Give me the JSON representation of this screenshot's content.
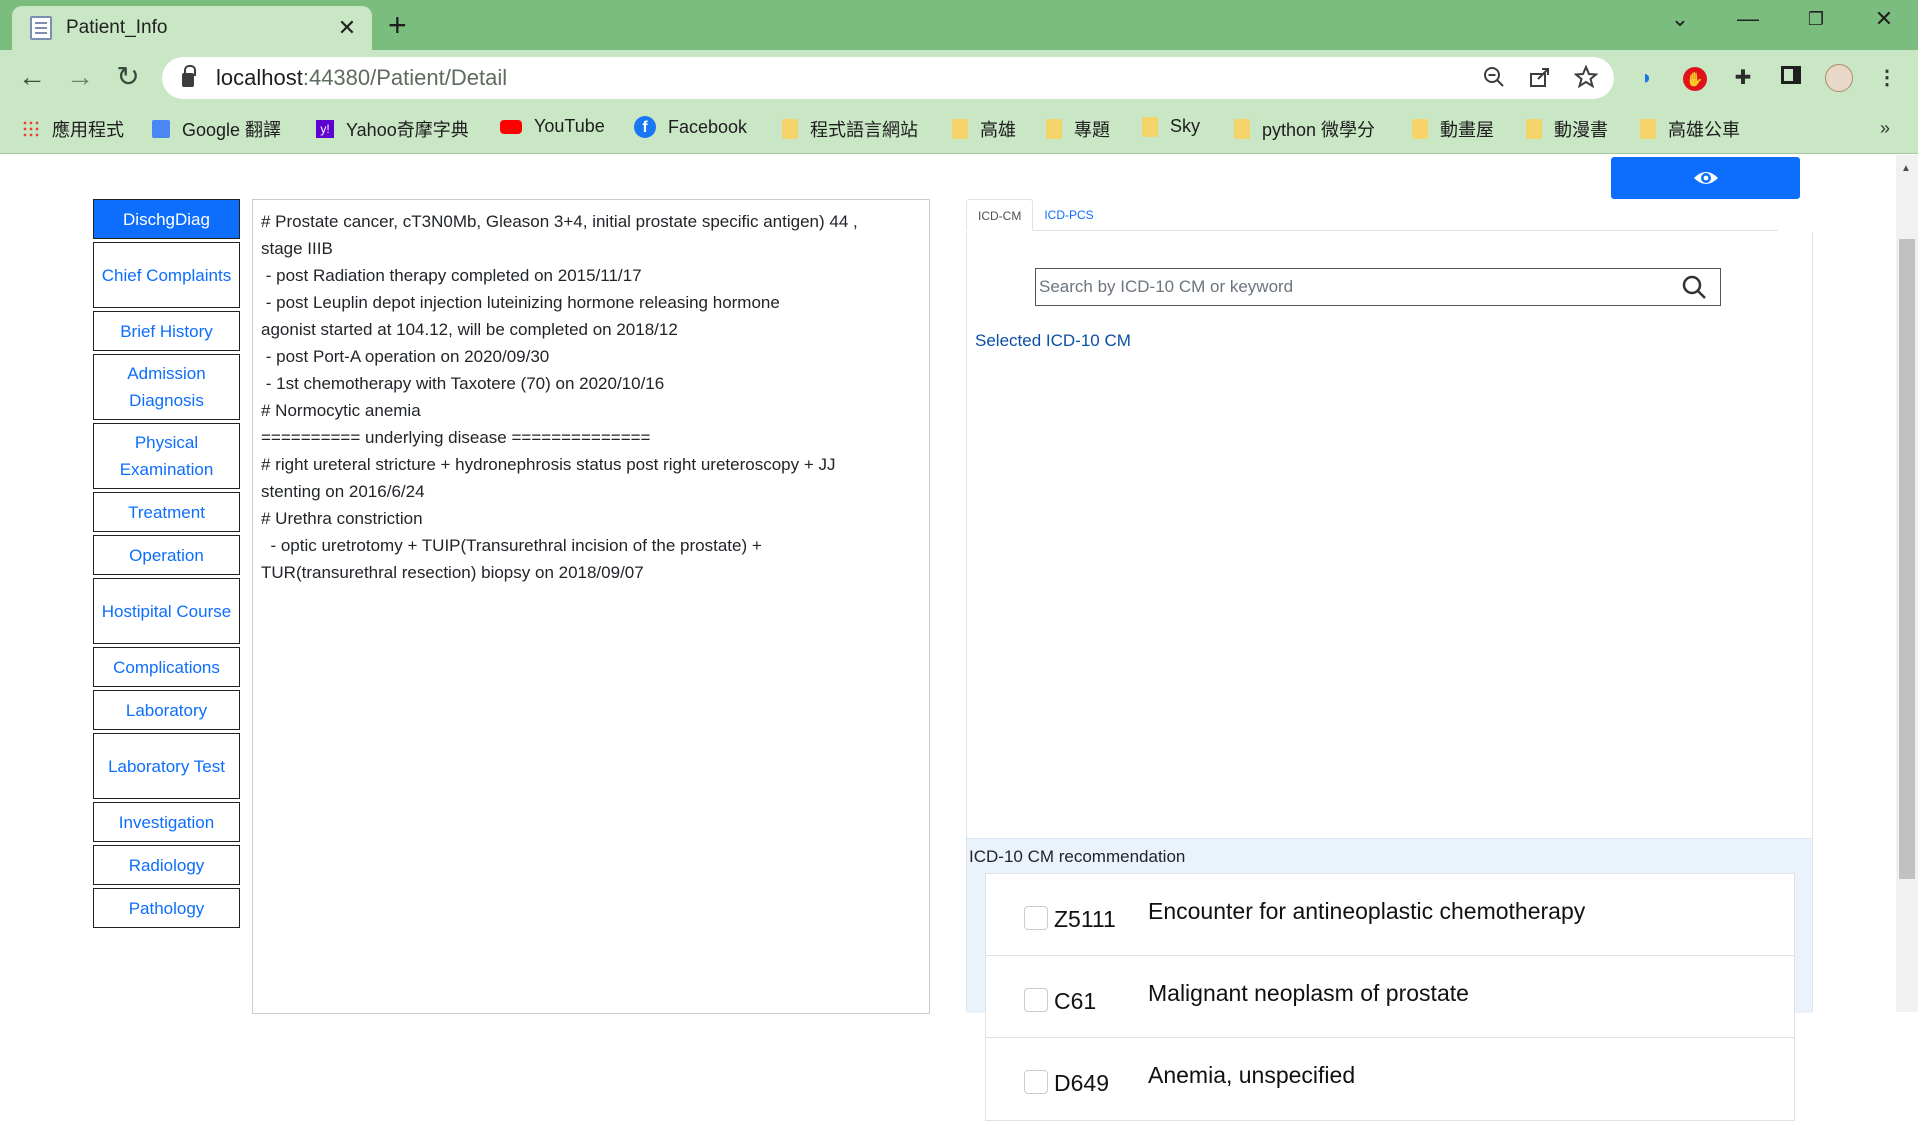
{
  "browser": {
    "tab_title": "Patient_Info",
    "tab_close": "✕",
    "new_tab": "+",
    "url_host": "localhost",
    "url_path": ":44380/Patient/Detail",
    "bookmarks": [
      {
        "label": "應用程式",
        "icon": "apps-grid-icon"
      },
      {
        "label": "Google 翻譯",
        "icon": "google-translate-icon"
      },
      {
        "label": "Yahoo奇摩字典",
        "icon": "yahoo-icon"
      },
      {
        "label": "YouTube",
        "icon": "youtube-icon"
      },
      {
        "label": "Facebook",
        "icon": "facebook-icon"
      },
      {
        "label": "程式語言網站",
        "icon": "folder-icon"
      },
      {
        "label": "高雄",
        "icon": "folder-icon"
      },
      {
        "label": "專題",
        "icon": "folder-icon"
      },
      {
        "label": "Sky",
        "icon": "folder-icon"
      },
      {
        "label": "python 微學分",
        "icon": "folder-icon"
      },
      {
        "label": "動畫屋",
        "icon": "folder-icon"
      },
      {
        "label": "動漫書",
        "icon": "folder-icon"
      },
      {
        "label": "高雄公車",
        "icon": "folder-icon"
      }
    ],
    "bookmarks_more": "»"
  },
  "sidenav": {
    "items": [
      {
        "label": "DischgDiag",
        "active": true
      },
      {
        "label": "Chief Complaints",
        "active": false
      },
      {
        "label": "Brief History",
        "active": false
      },
      {
        "label": "Admission Diagnosis",
        "active": false
      },
      {
        "label": "Physical Examination",
        "active": false
      },
      {
        "label": "Treatment",
        "active": false
      },
      {
        "label": "Operation",
        "active": false
      },
      {
        "label": "Hostipital Course",
        "active": false
      },
      {
        "label": "Complications",
        "active": false
      },
      {
        "label": "Laboratory",
        "active": false
      },
      {
        "label": "Laboratory Test",
        "active": false
      },
      {
        "label": "Investigation",
        "active": false
      },
      {
        "label": "Radiology",
        "active": false
      },
      {
        "label": "Pathology",
        "active": false
      }
    ]
  },
  "notes": {
    "lines": [
      "# Prostate cancer, cT3N0Mb, Gleason 3+4, initial prostate specific antigen) 44 ,",
      "stage IIIB",
      " - post Radiation therapy completed on 2015/11/17",
      " - post Leuplin depot injection luteinizing hormone releasing hormone",
      "agonist started at 104.12, will be completed on 2018/12",
      " - post Port-A operation on 2020/09/30",
      " - 1st chemotherapy with Taxotere (70) on 2020/10/16",
      "# Normocytic anemia",
      "========== underlying disease ==============",
      "# right ureteral stricture + hydronephrosis status post right ureteroscopy + JJ",
      "stenting on 2016/6/24",
      "# Urethra constriction",
      "  - optic uretrotomy + TUIP(Transurethral incision of the prostate) +",
      "TUR(transurethral resection) biopsy on 2018/09/07"
    ]
  },
  "icd": {
    "tabs": [
      {
        "label": "ICD-CM",
        "active": true
      },
      {
        "label": "ICD-PCS",
        "active": false
      }
    ],
    "search_placeholder": "Search by ICD-10 CM or keyword",
    "search_value": "",
    "selected_label": "Selected ICD-10 CM",
    "recommendation_title": "ICD-10 CM recommendation",
    "recommendations": [
      {
        "code": "Z5111",
        "description": "Encounter for antineoplastic chemotherapy",
        "checked": false
      },
      {
        "code": "C61",
        "description": "Malignant neoplasm of prostate",
        "checked": false
      },
      {
        "code": "D649",
        "description": "Anemia, unspecified",
        "checked": false
      }
    ]
  },
  "colors": {
    "primary": "#0d6efd",
    "browser_frame": "#7bbd7e",
    "browser_toolbar": "#c9e6c5",
    "recommendation_bg": "#eaf2fc"
  }
}
